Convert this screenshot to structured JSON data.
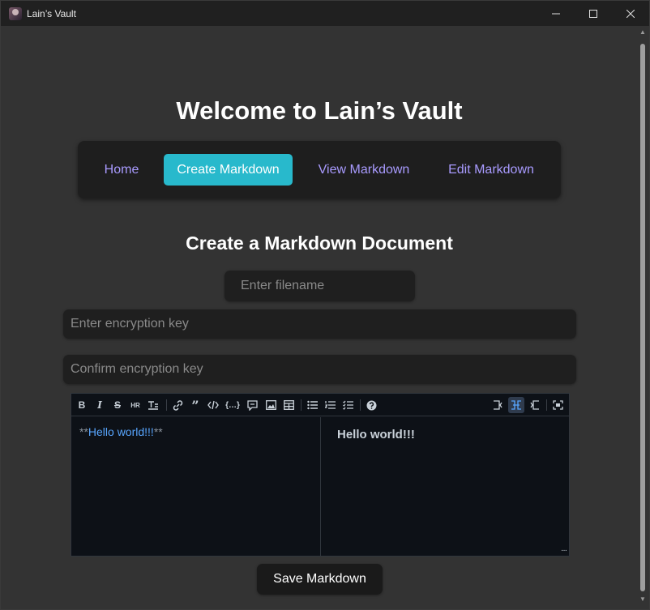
{
  "window": {
    "title": "Lain’s Vault",
    "controls": [
      "minimize-icon",
      "maximize-icon",
      "close-icon"
    ]
  },
  "page": {
    "title": "Welcome to Lain’s Vault"
  },
  "nav": {
    "items": [
      {
        "label": "Home",
        "active": false
      },
      {
        "label": "Create Markdown",
        "active": true
      },
      {
        "label": "View Markdown",
        "active": false
      },
      {
        "label": "Edit Markdown",
        "active": false
      }
    ]
  },
  "form": {
    "heading": "Create a Markdown Document",
    "filename": {
      "placeholder": "Enter filename",
      "value": ""
    },
    "encryption_key": {
      "placeholder": "Enter encryption key",
      "value": ""
    },
    "confirm_key": {
      "placeholder": "Confirm encryption key",
      "value": ""
    },
    "save_label": "Save Markdown"
  },
  "editor": {
    "toolbar": [
      "bold-icon",
      "italic-icon",
      "strikethrough-icon",
      "horizontal-rule-icon",
      "title-icon",
      "link-icon",
      "quote-icon",
      "code-icon",
      "code-block-icon",
      "comment-icon",
      "image-icon",
      "table-icon",
      "unordered-list-icon",
      "ordered-list-icon",
      "checked-list-icon",
      "help-icon",
      "edit-mode-icon",
      "live-mode-icon",
      "preview-mode-icon",
      "fullscreen-icon"
    ],
    "active_mode": "live",
    "source": {
      "prefix": "**",
      "text": "Hello world!!!",
      "suffix": "**"
    },
    "preview": "Hello world!!!",
    "colors": {
      "background": "#0d1117",
      "accent": "#58a6ff"
    }
  },
  "theme": {
    "nav_active_bg": "#28b9cc",
    "nav_link": "#a99bff"
  }
}
